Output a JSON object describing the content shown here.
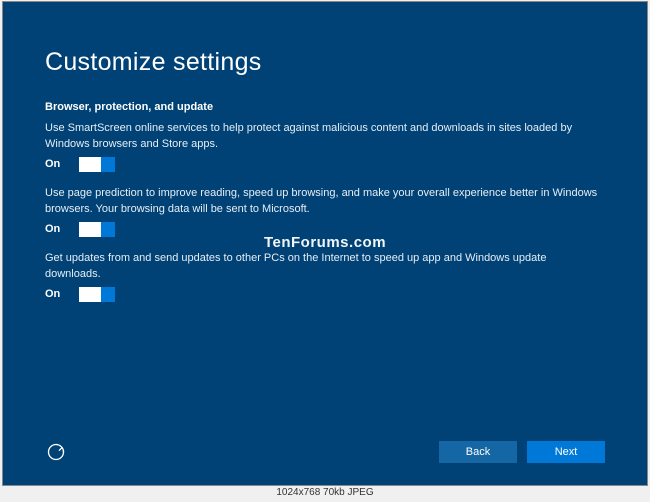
{
  "title": "Customize settings",
  "section_heading": "Browser, protection, and update",
  "settings": [
    {
      "desc": "Use SmartScreen online services to help protect against malicious content and downloads in sites loaded by Windows browsers and Store apps.",
      "state": "On"
    },
    {
      "desc": "Use page prediction to improve reading, speed up browsing, and make your overall experience better in Windows browsers. Your browsing data will be sent to Microsoft.",
      "state": "On"
    },
    {
      "desc": "Get updates from and send updates to other PCs on the Internet to speed up app and Windows update downloads.",
      "state": "On"
    }
  ],
  "watermark": "TenForums.com",
  "buttons": {
    "back": "Back",
    "next": "Next"
  },
  "meta": "1024x768  70kb  JPEG"
}
